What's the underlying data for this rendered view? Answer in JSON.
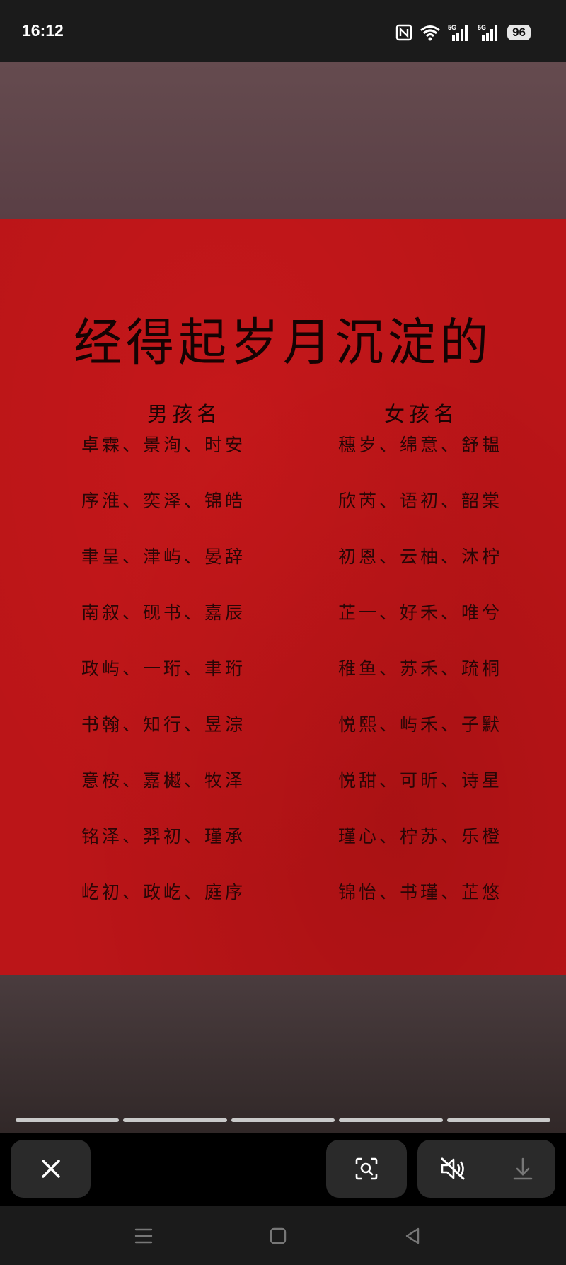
{
  "status_bar": {
    "time": "16:12",
    "battery": "96",
    "icons": [
      "nfc-icon",
      "wifi-icon",
      "signal-5g-icon",
      "signal-5g-icon",
      "battery-icon"
    ]
  },
  "poster": {
    "title": "经得起岁月沉淀的",
    "boys_header": "男孩名",
    "girls_header": "女孩名",
    "boys_names": [
      "卓霖、景洵、时安",
      "序淮、奕泽、锦皓",
      "聿呈、津屿、晏辞",
      "南叙、砚书、嘉辰",
      "政屿、一珩、聿珩",
      "书翰、知行、昱淙",
      "意桉、嘉樾、牧泽",
      "铭泽、羿初、瑾承",
      "屹初、政屹、庭序"
    ],
    "girls_names": [
      "穗岁、绵意、舒韫",
      "欣芮、语初、韶棠",
      "初恩、云柚、沐柠",
      "芷一、好禾、唯兮",
      "稚鱼、苏禾、疏桐",
      "悦熙、屿禾、子默",
      "悦甜、可昕、诗星",
      "瑾心、柠苏、乐橙",
      "锦怡、书瑾、芷悠"
    ]
  },
  "progress": {
    "segments": 5,
    "active_segment": 5
  },
  "toolbar": {
    "close": "close-icon",
    "lens": "image-search-icon",
    "mute": "mute-icon",
    "download": "download-icon"
  },
  "nav_bar": [
    "menu-icon",
    "home-icon",
    "back-icon"
  ],
  "colors": {
    "poster_red": "#bb1518",
    "ink": "#1c0404",
    "bar": "#1b1b1b"
  }
}
